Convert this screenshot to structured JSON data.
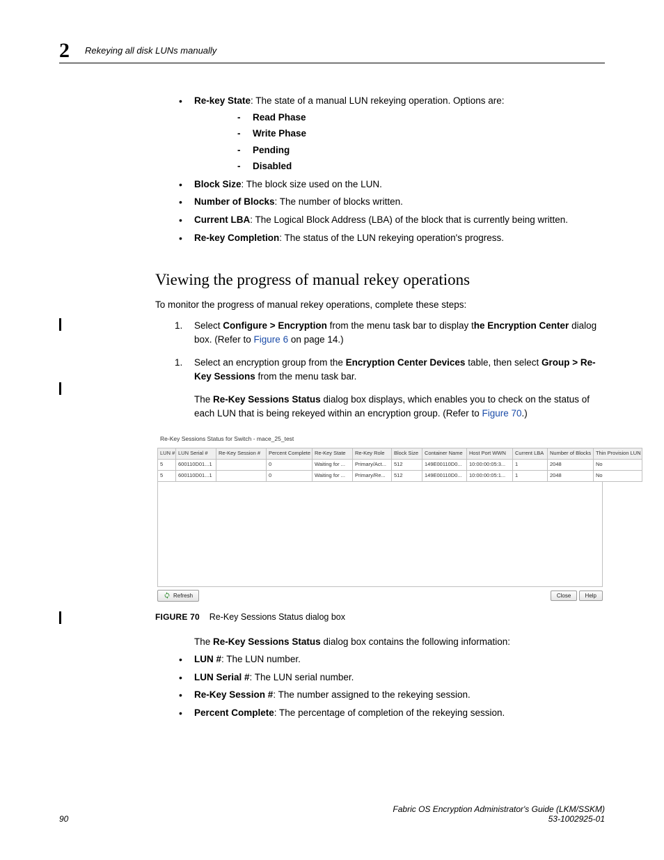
{
  "header": {
    "chapter_number": "2",
    "section_title": "Rekeying all disk LUNs manually"
  },
  "defs": {
    "rekey_state_label": "Re-key State",
    "rekey_state_desc": ": The state of a manual LUN rekeying operation. Options are:",
    "phases": [
      "Read Phase",
      "Write Phase",
      "Pending",
      "Disabled"
    ],
    "block_size_label": "Block Size",
    "block_size_desc": ": The block size used on the LUN.",
    "num_blocks_label": "Number of Blocks",
    "num_blocks_desc": ": The number of blocks written.",
    "current_lba_label": "Current LBA",
    "current_lba_desc": ": The Logical Block Address (LBA) of the block that is currently being written.",
    "rekey_completion_label": "Re-key Completion",
    "rekey_completion_desc": ": The status of the LUN rekeying operation's progress."
  },
  "subsection_heading": "Viewing the progress of manual rekey operations",
  "intro_para": "To monitor the progress of manual rekey operations, complete these steps:",
  "steps": {
    "s1_pre": "Select ",
    "s1_menu": "Configure > Encryption",
    "s1_mid": " from the menu task bar to display t",
    "s1_bold2": "he Encryption Center",
    "s1_post1": " dialog box. (Refer to ",
    "s1_link": "Figure 6",
    "s1_post2": " on page 14.)",
    "s2_pre": "Select an encryption group from the ",
    "s2_bold1": "Encryption Center Devices",
    "s2_mid": " table, then select ",
    "s2_bold2": "Group > Re-Key Sessions",
    "s2_post": " from the menu task bar.",
    "s2b_pre": "The ",
    "s2b_bold": "Re-Key Sessions Status",
    "s2b_mid": " dialog box displays, which enables you to check on the status of each LUN that is being rekeyed within an encryption group. (Refer to ",
    "s2b_link": "Figure 70",
    "s2b_post": ".)"
  },
  "dialog": {
    "title": "Re-Key Sessions Status for Switch - mace_25_test",
    "columns": [
      "LUN #",
      "LUN Serial #",
      "Re-Key Session #",
      "Percent Complete",
      "Re-Key State",
      "Re-Key Role",
      "Block Size",
      "Container Name",
      "Host Port WWN",
      "Current LBA",
      "Number of Blocks",
      "Thin Provision LUN"
    ],
    "rows": [
      {
        "lun": "5",
        "serial": "600110D01...1",
        "session": "",
        "pct": "0",
        "state": "Waiting for ...",
        "role": "Primary/Act...",
        "bsize": "512",
        "container": "149E00110D0...",
        "hostwwn": "10:00:00:05:3...",
        "lba": "1",
        "nblocks": "2048",
        "thin": "No"
      },
      {
        "lun": "5",
        "serial": "600110D01...1",
        "session": "",
        "pct": "0",
        "state": "Waiting for ...",
        "role": "Primary/Re...",
        "bsize": "512",
        "container": "149E00110D0...",
        "hostwwn": "10:00:00:05:1...",
        "lba": "1",
        "nblocks": "2048",
        "thin": "No"
      }
    ],
    "refresh_label": "Refresh",
    "close_label": "Close",
    "help_label": "Help"
  },
  "figure": {
    "number": "FIGURE 70",
    "caption": "Re-Key Sessions Status dialog box"
  },
  "post_fig": {
    "pre": "The ",
    "bold": "Re-Key Sessions Status",
    "post": " dialog box contains the following information:"
  },
  "info_list": {
    "lun_num_label": "LUN #",
    "lun_num_desc": ": The LUN number.",
    "lun_serial_label": "LUN Serial #",
    "lun_serial_desc": ": The LUN serial number.",
    "rk_session_label": "Re-Key Session #",
    "rk_session_desc": ": The number assigned to the rekeying session.",
    "pct_label": "Percent Complete",
    "pct_desc": ": The percentage of completion of the rekeying session."
  },
  "footer": {
    "page": "90",
    "doc_title": "Fabric OS Encryption Administrator's Guide  (LKM/SSKM)",
    "doc_num": "53-1002925-01"
  }
}
